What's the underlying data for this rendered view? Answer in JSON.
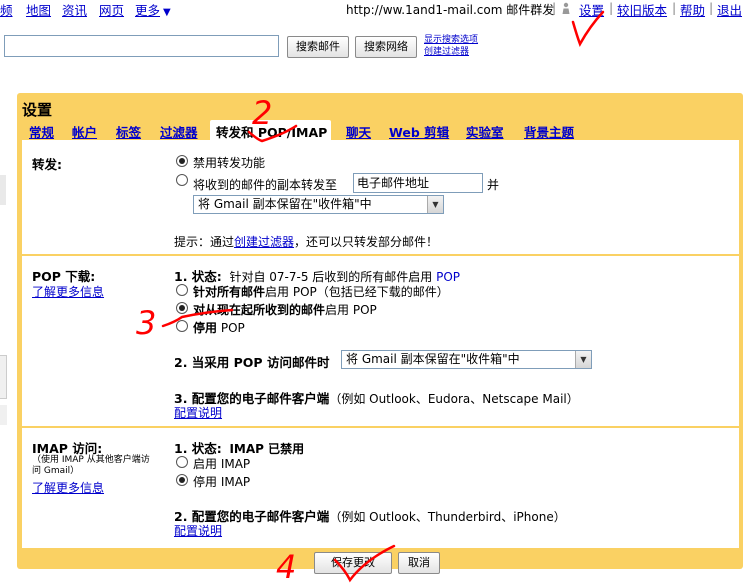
{
  "top_nav": {
    "items": [
      "频",
      "地图",
      "资讯",
      "网页",
      "更多"
    ],
    "more_arrow": "▼"
  },
  "top_right": {
    "email": "http://ww.1and1-mail.com 邮件群发",
    "separator": "|",
    "settings": "设置",
    "old_version": "较旧版本",
    "help": "帮助",
    "logout": "退出"
  },
  "search": {
    "search_mail_button": "搜索邮件",
    "search_web_button": "搜索网络",
    "show_options_link": "显示搜索选项",
    "create_filter_link": "创建过滤器"
  },
  "settings": {
    "title": "设置",
    "tabs": [
      "常规",
      "帐户",
      "标签",
      "过滤器",
      "转发和 POP/IMAP",
      "聊天",
      "Web 剪辑",
      "实验室",
      "背景主题"
    ]
  },
  "forwarding": {
    "label": "转发:",
    "disable_option": "禁用转发功能",
    "forward_option": "将收到的邮件的副本转发至",
    "email_address_value": "电子邮件地址",
    "and_text": "并",
    "keep_copy_select": "将 Gmail 副本保留在\"收件箱\"中",
    "tip_prefix": "提示：通过",
    "tip_link": "创建过滤器",
    "tip_suffix": "，还可以只转发部分邮件！"
  },
  "pop": {
    "label": "POP 下载:",
    "learn_more": "了解更多信息",
    "status_heading": "1. 状态:",
    "status_text": "针对自 07-7-5 后收到的所有邮件启用",
    "status_pop": "POP",
    "option_all_bold": "针对所有邮件",
    "option_all_rest": "启用 POP（包括已经下载的邮件）",
    "option_from_now_bold": "对从现在起所收到的邮件",
    "option_from_now_rest": "启用 POP",
    "option_disable_bold": "停用",
    "option_disable_rest": "POP",
    "when_accessed_heading": "2. 当采用 POP 访问邮件时",
    "when_accessed_select": "将 Gmail 副本保留在\"收件箱\"中",
    "configure_heading": "3. 配置您的电子邮件客户端",
    "configure_examples": "（例如 Outlook、Eudora、Netscape Mail）",
    "configure_link": "配置说明"
  },
  "imap": {
    "label": "IMAP 访问:",
    "note_line1": "（使用 IMAP 从其他客户端访",
    "note_line2": "问 Gmail）",
    "learn_more": "了解更多信息",
    "status_heading": "1. 状态:",
    "status_text": "IMAP 已禁用",
    "enable_option": "启用 IMAP",
    "disable_option": "停用 IMAP",
    "configure_heading": "2. 配置您的电子邮件客户端",
    "configure_examples": "（例如 Outlook、Thunderbird、iPhone）",
    "configure_link": "配置说明"
  },
  "actions": {
    "save_button": "保存更改",
    "cancel_button": "取消"
  },
  "annotations": {
    "step2": "2",
    "step3": "3",
    "step4": "4",
    "color": "#ff0000"
  },
  "colors": {
    "panel_bg": "#fad163",
    "link": "#0000cc"
  }
}
